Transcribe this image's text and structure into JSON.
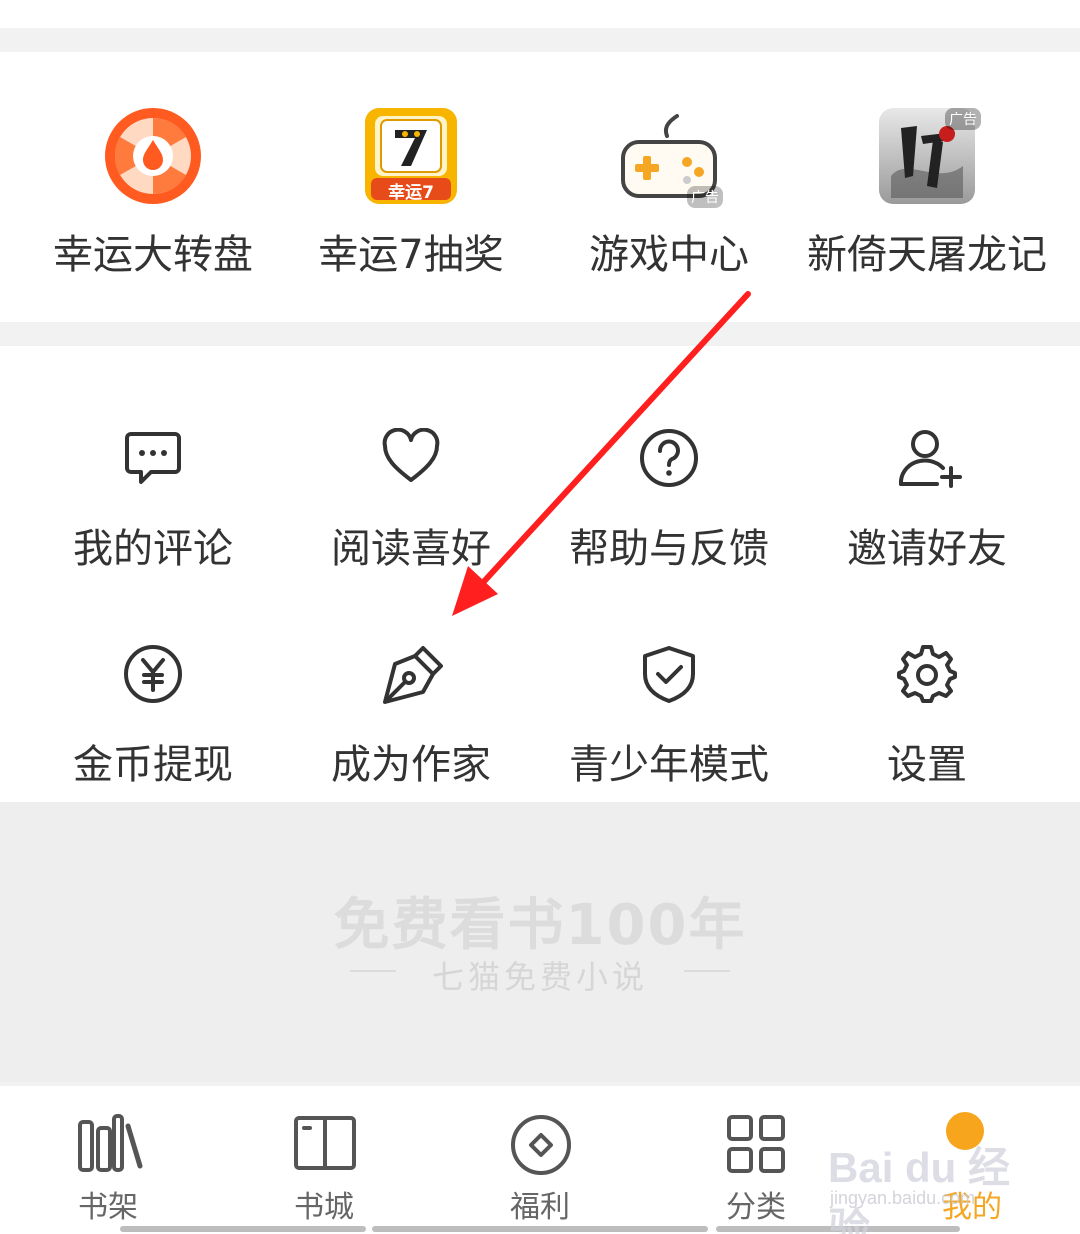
{
  "promo_row": [
    {
      "label": "幸运大转盘",
      "icon": "spin-wheel-icon"
    },
    {
      "label": "幸运7抽奖",
      "icon": "lucky-seven-icon",
      "icon_text": "幸运7"
    },
    {
      "label": "游戏中心",
      "icon": "gamepad-icon",
      "badge": "广告"
    },
    {
      "label": "新倚天屠龙记",
      "icon": "game-cover-icon",
      "badge": "广告"
    }
  ],
  "tools": [
    {
      "label": "我的评论",
      "icon": "comment-icon"
    },
    {
      "label": "阅读喜好",
      "icon": "heart-icon"
    },
    {
      "label": "帮助与反馈",
      "icon": "help-icon"
    },
    {
      "label": "邀请好友",
      "icon": "add-user-icon"
    },
    {
      "label": "金币提现",
      "icon": "yen-coin-icon"
    },
    {
      "label": "成为作家",
      "icon": "pen-nib-icon"
    },
    {
      "label": "青少年模式",
      "icon": "shield-check-icon"
    },
    {
      "label": "设置",
      "icon": "gear-icon"
    }
  ],
  "slogan": {
    "main": "免费看书100年",
    "sub": "七猫免费小说"
  },
  "bottom_nav": [
    {
      "label": "书架",
      "icon": "bookshelf-icon",
      "active": false
    },
    {
      "label": "书城",
      "icon": "book-open-icon",
      "active": false
    },
    {
      "label": "福利",
      "icon": "diamond-circle-icon",
      "active": false
    },
    {
      "label": "分类",
      "icon": "grid-icon",
      "active": false
    },
    {
      "label": "我的",
      "icon": "profile-dot-icon",
      "active": true
    }
  ],
  "watermark": {
    "text": "Bai du 经验",
    "sub": "jingyan.baidu.com"
  },
  "colors": {
    "accent": "#f5a623",
    "annotation": "#ff1f1f",
    "wheel": "#ff5a1f"
  }
}
